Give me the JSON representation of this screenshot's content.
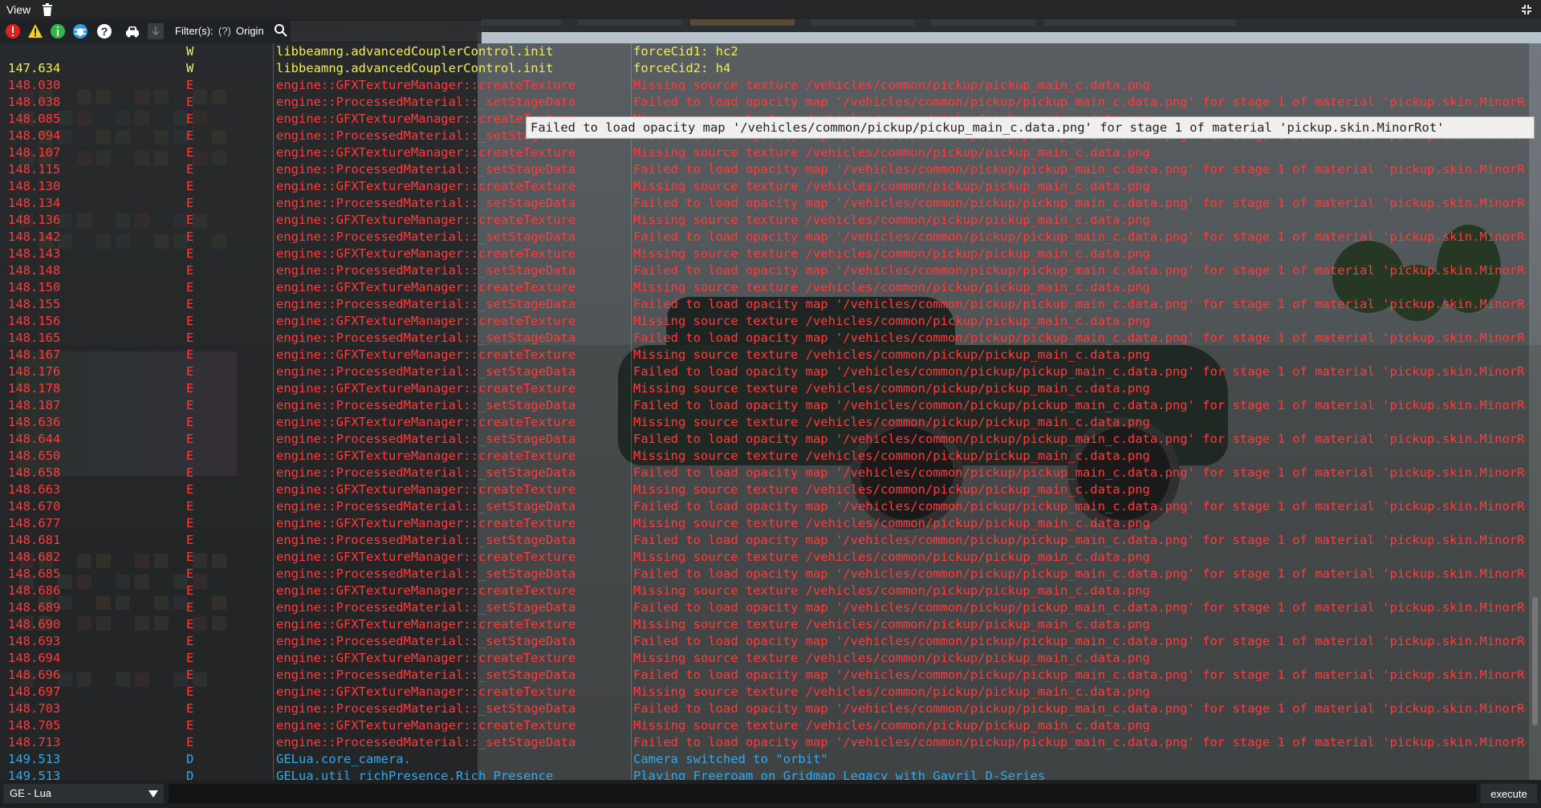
{
  "window": {
    "view_menu": "View",
    "filter_label": "Filter(s):",
    "filter_help": "(?)",
    "origin_label": "Origin",
    "filter_value": ""
  },
  "colors": {
    "warn": "#f0f050",
    "error": "#ff3b3b",
    "debug": "#2eaaf0"
  },
  "toolbar_icons": [
    "error-filter-icon",
    "warning-filter-icon",
    "info-filter-icon",
    "debug-filter-icon",
    "help-filter-icon",
    "vehicle-filter-icon",
    "download-icon"
  ],
  "log": [
    {
      "time": "",
      "level": "W",
      "origin": "libbeamng.advancedCouplerControl.init",
      "message": "forceCid1: hc2",
      "kind": "warn"
    },
    {
      "time": "147.634",
      "level": "W",
      "origin": "libbeamng.advancedCouplerControl.init",
      "message": "forceCid2: h4",
      "kind": "warn"
    },
    {
      "time": "148.030",
      "level": "E",
      "origin": "engine::GFXTextureManager::createTexture",
      "message": "Missing source texture /vehicles/common/pickup/pickup_main_c.data.png",
      "kind": "error"
    },
    {
      "time": "148.038",
      "level": "E",
      "origin": "engine::ProcessedMaterial::_setStageData",
      "message": "Failed to load opacity map '/vehicles/common/pickup/pickup_main_c.data.png' for stage 1 of material 'pickup.skin.MinorRot'",
      "kind": "error"
    },
    {
      "time": "148.085",
      "level": "E",
      "origin": "engine::GFXTextureManager::createTexture",
      "message": "Missing source texture /vehicles/common/pickup/pickup_main_c.data.png",
      "kind": "error"
    },
    {
      "time": "148.094",
      "level": "E",
      "origin": "engine::ProcessedMaterial::_setStageData",
      "message": "Failed to load opacity map '/vehicles/common/pickup/pickup_main_c.data.png' for stage 1 of material 'pickup.skin.MinorRot'",
      "kind": "error"
    },
    {
      "time": "148.107",
      "level": "E",
      "origin": "engine::GFXTextureManager::createTexture",
      "message": "Missing source texture /vehicles/common/pickup/pickup_main_c.data.png",
      "kind": "error"
    },
    {
      "time": "148.115",
      "level": "E",
      "origin": "engine::ProcessedMaterial::_setStageData",
      "message": "Failed to load opacity map '/vehicles/common/pickup/pickup_main_c.data.png' for stage 1 of material 'pickup.skin.MinorRot'",
      "kind": "error"
    },
    {
      "time": "148.130",
      "level": "E",
      "origin": "engine::GFXTextureManager::createTexture",
      "message": "Missing source texture /vehicles/common/pickup/pickup_main_c.data.png",
      "kind": "error"
    },
    {
      "time": "148.134",
      "level": "E",
      "origin": "engine::ProcessedMaterial::_setStageData",
      "message": "Failed to load opacity map '/vehicles/common/pickup/pickup_main_c.data.png' for stage 1 of material 'pickup.skin.MinorRot'",
      "kind": "error"
    },
    {
      "time": "148.136",
      "level": "E",
      "origin": "engine::GFXTextureManager::createTexture",
      "message": "Missing source texture /vehicles/common/pickup/pickup_main_c.data.png",
      "kind": "error"
    },
    {
      "time": "148.142",
      "level": "E",
      "origin": "engine::ProcessedMaterial::_setStageData",
      "message": "Failed to load opacity map '/vehicles/common/pickup/pickup_main_c.data.png' for stage 1 of material 'pickup.skin.MinorRot'",
      "kind": "error"
    },
    {
      "time": "148.143",
      "level": "E",
      "origin": "engine::GFXTextureManager::createTexture",
      "message": "Missing source texture /vehicles/common/pickup/pickup_main_c.data.png",
      "kind": "error"
    },
    {
      "time": "148.148",
      "level": "E",
      "origin": "engine::ProcessedMaterial::_setStageData",
      "message": "Failed to load opacity map '/vehicles/common/pickup/pickup_main_c.data.png' for stage 1 of material 'pickup.skin.MinorRot'",
      "kind": "error"
    },
    {
      "time": "148.150",
      "level": "E",
      "origin": "engine::GFXTextureManager::createTexture",
      "message": "Missing source texture /vehicles/common/pickup/pickup_main_c.data.png",
      "kind": "error"
    },
    {
      "time": "148.155",
      "level": "E",
      "origin": "engine::ProcessedMaterial::_setStageData",
      "message": "Failed to load opacity map '/vehicles/common/pickup/pickup_main_c.data.png' for stage 1 of material 'pickup.skin.MinorRot'",
      "kind": "error"
    },
    {
      "time": "148.156",
      "level": "E",
      "origin": "engine::GFXTextureManager::createTexture",
      "message": "Missing source texture /vehicles/common/pickup/pickup_main_c.data.png",
      "kind": "error"
    },
    {
      "time": "148.165",
      "level": "E",
      "origin": "engine::ProcessedMaterial::_setStageData",
      "message": "Failed to load opacity map '/vehicles/common/pickup/pickup_main_c.data.png' for stage 1 of material 'pickup.skin.MinorRot'",
      "kind": "error"
    },
    {
      "time": "148.167",
      "level": "E",
      "origin": "engine::GFXTextureManager::createTexture",
      "message": "Missing source texture /vehicles/common/pickup/pickup_main_c.data.png",
      "kind": "error"
    },
    {
      "time": "148.176",
      "level": "E",
      "origin": "engine::ProcessedMaterial::_setStageData",
      "message": "Failed to load opacity map '/vehicles/common/pickup/pickup_main_c.data.png' for stage 1 of material 'pickup.skin.MinorRot'",
      "kind": "error"
    },
    {
      "time": "148.178",
      "level": "E",
      "origin": "engine::GFXTextureManager::createTexture",
      "message": "Missing source texture /vehicles/common/pickup/pickup_main_c.data.png",
      "kind": "error"
    },
    {
      "time": "148.187",
      "level": "E",
      "origin": "engine::ProcessedMaterial::_setStageData",
      "message": "Failed to load opacity map '/vehicles/common/pickup/pickup_main_c.data.png' for stage 1 of material 'pickup.skin.MinorRot'",
      "kind": "error"
    },
    {
      "time": "148.636",
      "level": "E",
      "origin": "engine::GFXTextureManager::createTexture",
      "message": "Missing source texture /vehicles/common/pickup/pickup_main_c.data.png",
      "kind": "error"
    },
    {
      "time": "148.644",
      "level": "E",
      "origin": "engine::ProcessedMaterial::_setStageData",
      "message": "Failed to load opacity map '/vehicles/common/pickup/pickup_main_c.data.png' for stage 1 of material 'pickup.skin.MinorRot'",
      "kind": "error"
    },
    {
      "time": "148.650",
      "level": "E",
      "origin": "engine::GFXTextureManager::createTexture",
      "message": "Missing source texture /vehicles/common/pickup/pickup_main_c.data.png",
      "kind": "error"
    },
    {
      "time": "148.658",
      "level": "E",
      "origin": "engine::ProcessedMaterial::_setStageData",
      "message": "Failed to load opacity map '/vehicles/common/pickup/pickup_main_c.data.png' for stage 1 of material 'pickup.skin.MinorRot'",
      "kind": "error"
    },
    {
      "time": "148.663",
      "level": "E",
      "origin": "engine::GFXTextureManager::createTexture",
      "message": "Missing source texture /vehicles/common/pickup/pickup_main_c.data.png",
      "kind": "error"
    },
    {
      "time": "148.670",
      "level": "E",
      "origin": "engine::ProcessedMaterial::_setStageData",
      "message": "Failed to load opacity map '/vehicles/common/pickup/pickup_main_c.data.png' for stage 1 of material 'pickup.skin.MinorRot'",
      "kind": "error"
    },
    {
      "time": "148.677",
      "level": "E",
      "origin": "engine::GFXTextureManager::createTexture",
      "message": "Missing source texture /vehicles/common/pickup/pickup_main_c.data.png",
      "kind": "error"
    },
    {
      "time": "148.681",
      "level": "E",
      "origin": "engine::ProcessedMaterial::_setStageData",
      "message": "Failed to load opacity map '/vehicles/common/pickup/pickup_main_c.data.png' for stage 1 of material 'pickup.skin.MinorRot'",
      "kind": "error"
    },
    {
      "time": "148.682",
      "level": "E",
      "origin": "engine::GFXTextureManager::createTexture",
      "message": "Missing source texture /vehicles/common/pickup/pickup_main_c.data.png",
      "kind": "error"
    },
    {
      "time": "148.685",
      "level": "E",
      "origin": "engine::ProcessedMaterial::_setStageData",
      "message": "Failed to load opacity map '/vehicles/common/pickup/pickup_main_c.data.png' for stage 1 of material 'pickup.skin.MinorRot'",
      "kind": "error"
    },
    {
      "time": "148.686",
      "level": "E",
      "origin": "engine::GFXTextureManager::createTexture",
      "message": "Missing source texture /vehicles/common/pickup/pickup_main_c.data.png",
      "kind": "error"
    },
    {
      "time": "148.689",
      "level": "E",
      "origin": "engine::ProcessedMaterial::_setStageData",
      "message": "Failed to load opacity map '/vehicles/common/pickup/pickup_main_c.data.png' for stage 1 of material 'pickup.skin.MinorRot'",
      "kind": "error"
    },
    {
      "time": "148.690",
      "level": "E",
      "origin": "engine::GFXTextureManager::createTexture",
      "message": "Missing source texture /vehicles/common/pickup/pickup_main_c.data.png",
      "kind": "error"
    },
    {
      "time": "148.693",
      "level": "E",
      "origin": "engine::ProcessedMaterial::_setStageData",
      "message": "Failed to load opacity map '/vehicles/common/pickup/pickup_main_c.data.png' for stage 1 of material 'pickup.skin.MinorRot'",
      "kind": "error"
    },
    {
      "time": "148.694",
      "level": "E",
      "origin": "engine::GFXTextureManager::createTexture",
      "message": "Missing source texture /vehicles/common/pickup/pickup_main_c.data.png",
      "kind": "error"
    },
    {
      "time": "148.696",
      "level": "E",
      "origin": "engine::ProcessedMaterial::_setStageData",
      "message": "Failed to load opacity map '/vehicles/common/pickup/pickup_main_c.data.png' for stage 1 of material 'pickup.skin.MinorRot'",
      "kind": "error"
    },
    {
      "time": "148.697",
      "level": "E",
      "origin": "engine::GFXTextureManager::createTexture",
      "message": "Missing source texture /vehicles/common/pickup/pickup_main_c.data.png",
      "kind": "error"
    },
    {
      "time": "148.703",
      "level": "E",
      "origin": "engine::ProcessedMaterial::_setStageData",
      "message": "Failed to load opacity map '/vehicles/common/pickup/pickup_main_c.data.png' for stage 1 of material 'pickup.skin.MinorRot'",
      "kind": "error"
    },
    {
      "time": "148.705",
      "level": "E",
      "origin": "engine::GFXTextureManager::createTexture",
      "message": "Missing source texture /vehicles/common/pickup/pickup_main_c.data.png",
      "kind": "error"
    },
    {
      "time": "148.713",
      "level": "E",
      "origin": "engine::ProcessedMaterial::_setStageData",
      "message": "Failed to load opacity map '/vehicles/common/pickup/pickup_main_c.data.png' for stage 1 of material 'pickup.skin.MinorRot'",
      "kind": "error"
    },
    {
      "time": "149.513",
      "level": "D",
      "origin": "GELua.core_camera.",
      "message": "Camera switched to \"orbit\"",
      "kind": "debug"
    },
    {
      "time": "149.513",
      "level": "D",
      "origin": "GELua.util_richPresence.Rich Presence",
      "message": "Playing Freeroam on Gridmap Legacy with Gavril D-Series",
      "kind": "debug"
    }
  ],
  "tooltip": "Failed to load opacity map '/vehicles/common/pickup/pickup_main_c.data.png' for stage 1 of material 'pickup.skin.MinorRot'",
  "bottom": {
    "context": "GE - Lua",
    "command_value": "",
    "execute_label": "execute"
  }
}
